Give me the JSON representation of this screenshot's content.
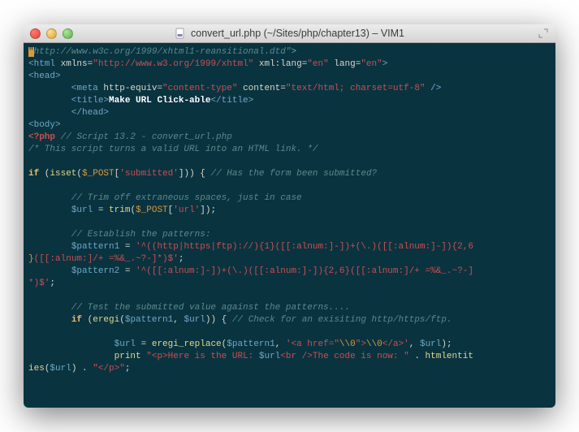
{
  "titlebar": {
    "title": "convert_url.php (~/Sites/php/chapter13) – VIM1"
  },
  "code": {
    "l01a": "\"",
    "l01b": "http://www.w3c.org/1999/xhtml1-reansitional.dtd\"",
    "l01c": ">",
    "l02a": "<html",
    "l02b": " xmlns=",
    "l02c": "\"http://www.w3.org/1999/xhtml\"",
    "l02d": " xml:lang=",
    "l02e": "\"en\"",
    "l02f": " lang=",
    "l02g": "\"en\"",
    "l02h": ">",
    "l03a": "<head>",
    "l04a": "        <meta",
    "l04b": " http-equiv=",
    "l04c": "\"content-type\"",
    "l04d": " content=",
    "l04e": "\"text/html; charset=utf-8\"",
    "l04f": " />",
    "l05a": "        <title>",
    "l05b": "Make URL Click-able",
    "l05c": "</title>",
    "l06a": "        </head>",
    "l07a": "<body>",
    "l08a": "<?php",
    "l08b": " // Script 13.2 - convert_url.php",
    "l09a": "/* This script turns a valid URL into an HTML link. */",
    "l11a": "if",
    "l11b": " (",
    "l11c": "isset",
    "l11d": "(",
    "l11e": "$_POST",
    "l11f": "[",
    "l11g": "'submitted'",
    "l11h": "]",
    "l11i": ")",
    "l11j": ") {",
    "l11k": " // Has the form been submitted?",
    "l13a": "        // Trim off extraneous spaces, just in case",
    "l14a": "        ",
    "l14b": "$url",
    "l14c": " = ",
    "l14d": "trim",
    "l14e": "(",
    "l14f": "$_POST",
    "l14g": "[",
    "l14h": "'url'",
    "l14i": "]",
    "l14j": ");",
    "l16a": "        // Establish the patterns:",
    "l17a": "        ",
    "l17b": "$pattern1",
    "l17c": " = ",
    "l17d": "'^((http|https|ftp)://){1}([[:alnum:]-])+(\\.)([[:alnum:]-]){2,6",
    "l18a": "}",
    "l18b": "([[:alnum:]/+ =%&_.~?-]*)$'",
    "l18c": ";",
    "l19a": "        ",
    "l19b": "$pattern2",
    "l19c": " = ",
    "l19d": "'^([[:alnum:]-])+(\\.)([[:alnum:]-]){2,6}([[:alnum:]/+ =%&_.~?-]",
    "l20a": "*)$'",
    "l20b": ";",
    "l22a": "        // Test the submitted value against the patterns....",
    "l23a": "        ",
    "l23b": "if",
    "l23c": " (",
    "l23d": "eregi",
    "l23e": "(",
    "l23f": "$pattern1",
    "l23g": ", ",
    "l23h": "$url",
    "l23i": ")",
    "l23j": ") {",
    "l23k": " // Check for an exisiting http/https/ftp.",
    "l25a": "                ",
    "l25b": "$url",
    "l25c": " = ",
    "l25d": "eregi_replace",
    "l25e": "(",
    "l25f": "$pattern1",
    "l25g": ", ",
    "l25h": "'<a href=\"",
    "l25i": "\\\\0",
    "l25j": "\">",
    "l25k": "\\\\0",
    "l25l": "</a>'",
    "l25m": ", ",
    "l25n": "$url",
    "l25o": ");",
    "l26a": "                ",
    "l26b": "print",
    "l26c": " ",
    "l26d": "\"<p>Here is the URL: ",
    "l26e": "$url",
    "l26f": "<br />The code is now: \"",
    "l26g": " . ",
    "l26h": "htmlentit",
    "l27a": "ies",
    "l27b": "(",
    "l27c": "$url",
    "l27d": ") . ",
    "l27e": "\"</p>\"",
    "l27f": ";"
  }
}
